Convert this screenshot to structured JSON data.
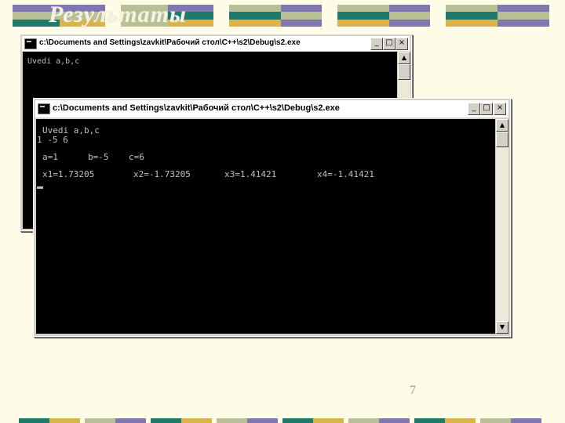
{
  "slide": {
    "title": "Результаты",
    "page_number": "7"
  },
  "window_back": {
    "title": "c:\\Documents and Settings\\zavkit\\Рабочий стол\\C++\\s2\\Debug\\s2.exe",
    "lines": [
      "Uvedi a,b,c"
    ],
    "buttons": {
      "minimize": "_",
      "maximize": "□",
      "close": "×"
    }
  },
  "window_front": {
    "title": "c:\\Documents and Settings\\zavkit\\Рабочий стол\\C++\\s2\\Debug\\s2.exe",
    "lines": {
      "prompt": "Uvedi a,b,c",
      "input": "1 -5 6",
      "coefficients": [
        "a=1",
        "b=-5",
        "c=6"
      ],
      "roots": [
        "x1=1.73205",
        "x2=-1.73205",
        "x3=1.41421",
        "x4=-1.41421"
      ]
    },
    "buttons": {
      "minimize": "_",
      "maximize": "□",
      "close": "×"
    },
    "scroll_arrows": {
      "up": "▲",
      "down": "▼"
    }
  },
  "colors": {
    "background": "#fefce6",
    "bar_teal": "#1f7a6e",
    "bar_purple": "#7f78b0",
    "bar_gold": "#d9b44a",
    "bar_sage": "#b8bf94",
    "console_bg": "#000000",
    "console_text": "#c0c0c0"
  }
}
